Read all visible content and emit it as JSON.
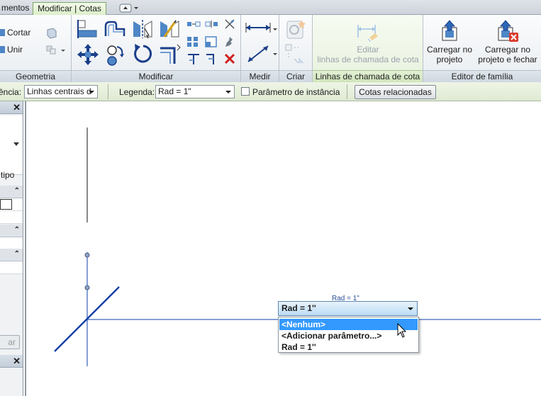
{
  "tabs": {
    "prev_partial": "mentos",
    "active": "Modificar | Cotas"
  },
  "ribbon": {
    "geometria": {
      "label": "Geometria",
      "cortar": "Cortar",
      "unir": "Unir"
    },
    "modificar": {
      "label": "Modificar"
    },
    "medir": {
      "label": "Medir"
    },
    "criar": {
      "label": "Criar"
    },
    "linhas_cota": {
      "label": "Linhas de chamada de cota",
      "editar_line1": "Editar",
      "editar_line2": "linhas de chamada de cota"
    },
    "editor_familia": {
      "label": "Editor de família",
      "carregar_line1": "Carregar no",
      "carregar_line2": "projeto",
      "carregar_fechar_line1": "Carregar no",
      "carregar_fechar_line2": "projeto e fechar"
    }
  },
  "options_bar": {
    "referencia_label": "ência:",
    "referencia_value": "Linhas centrais d",
    "legenda_label": "Legenda:",
    "legenda_value": "Rad = 1\"",
    "parametro_instancia": "Parâmetro de instância",
    "cotas_relacionadas": "Cotas relacionadas"
  },
  "palette": {
    "tipo_partial": "tipo",
    "apply_partial": "ar"
  },
  "canvas": {
    "dim_label": "Rad = 1\"",
    "dropdown_value": "Rad = 1''",
    "dropdown_items": [
      "<Nenhum>",
      "<Adicionar parâmetro...>",
      "Rad = 1''"
    ]
  },
  "colors": {
    "accent_green": "#7fa76a",
    "selection_blue": "#3399ff",
    "line_blue": "#0b3fa8"
  }
}
